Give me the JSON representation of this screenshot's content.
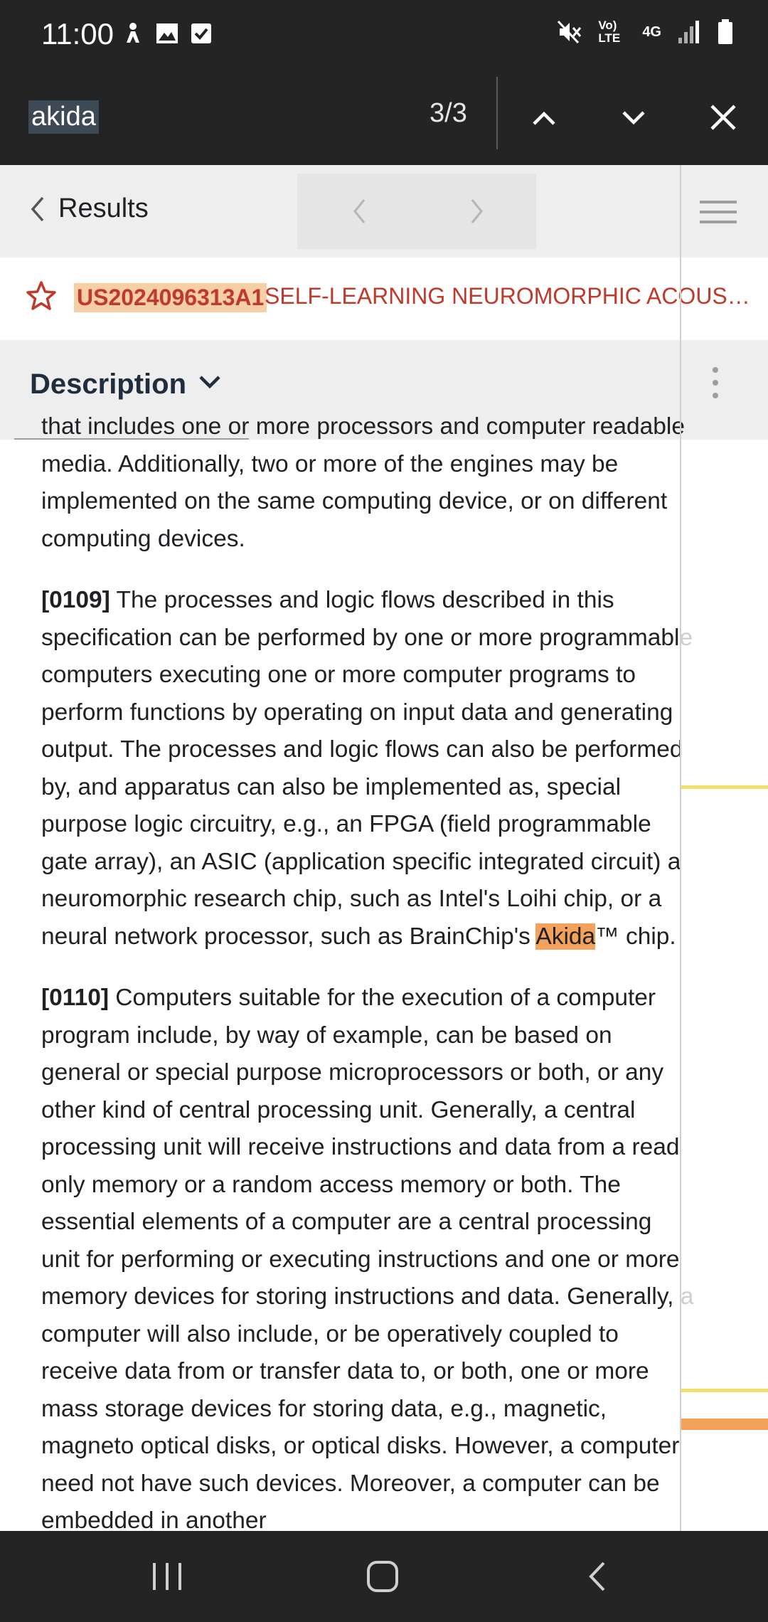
{
  "status": {
    "time": "11:00",
    "network_label": "Vo) LTE",
    "network_type": "4G"
  },
  "find": {
    "query": "akida",
    "count": "3/3"
  },
  "nav": {
    "back_label": "Results"
  },
  "patent": {
    "number": "US2024096313A1",
    "title": "SELF-LEARNING NEUROMORPHIC ACOUSTI..."
  },
  "section": {
    "label": "Description"
  },
  "content": {
    "top_fragment": "that includes one or more processors and computer readable media. Additionally, two or more of the engines may be implemented on the same computing device, or on different computing devices.",
    "p0109_num": "[0109]",
    "p0109_text_a": " The processes and logic flows described in this specification can be performed by one or more programmable computers executing one or more computer programs to perform functions by operating on input data and generating output. The processes and logic flows can also be performed by, and apparatus can also be implemented as, special purpose logic circuitry, e.g., an FPGA (field programmable gate array), an ASIC (application specific integrated circuit) a neuromorphic research chip, such as Intel's Loihi chip, or a neural network processor, such as BrainChip's ",
    "p0109_highlight": "Akida",
    "p0109_text_b": "™ chip.",
    "p0110_num": "[0110]",
    "p0110_text": " Computers suitable for the execution of a computer program include, by way of example, can be based on general or special purpose microprocessors or both, or any other kind of central processing unit. Generally, a central processing unit will receive instructions and data from a read only memory or a random access memory or both. The essential elements of a computer are a central processing unit for performing or executing instructions and one or more memory devices for storing instructions and data. Generally, a computer will also include, or be operatively coupled to receive data from or transfer data to, or both, one or more mass storage devices for storing data, e.g., magnetic, magneto optical disks, or optical disks. However, a computer need not have such devices. Moreover, a computer can be embedded in another"
  },
  "colors": {
    "highlight_active": "#f4a25b",
    "highlight_match": "#f0df6a",
    "title_red": "#c0392b"
  }
}
